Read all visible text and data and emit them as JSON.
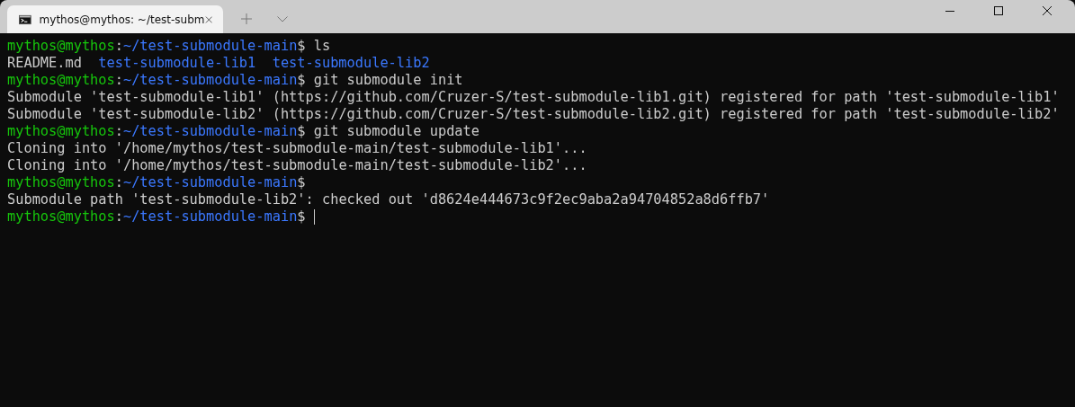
{
  "window": {
    "tabs": [
      {
        "title": "mythos@mythos: ~/test-subm",
        "selected": true
      }
    ]
  },
  "terminal": {
    "lines": [
      {
        "kind": "prompt",
        "user": "mythos@mythos",
        "sep": ":",
        "path": "~/test-submodule-main",
        "command": "$ ls"
      },
      {
        "kind": "listing",
        "items": [
          {
            "kind": "file",
            "text": "README.md"
          },
          {
            "kind": "dir",
            "text": "test-submodule-lib1"
          },
          {
            "kind": "dir",
            "text": "test-submodule-lib2"
          }
        ]
      },
      {
        "kind": "prompt",
        "user": "mythos@mythos",
        "sep": ":",
        "path": "~/test-submodule-main",
        "command": "$ git submodule init"
      },
      {
        "kind": "output",
        "text": "Submodule 'test-submodule-lib1' (https://github.com/Cruzer-S/test-submodule-lib1.git) registered for path 'test-submodule-lib1'"
      },
      {
        "kind": "output",
        "text": "Submodule 'test-submodule-lib2' (https://github.com/Cruzer-S/test-submodule-lib2.git) registered for path 'test-submodule-lib2'"
      },
      {
        "kind": "prompt",
        "user": "mythos@mythos",
        "sep": ":",
        "path": "~/test-submodule-main",
        "command": "$ git submodule update"
      },
      {
        "kind": "output",
        "text": "Cloning into '/home/mythos/test-submodule-main/test-submodule-lib1'..."
      },
      {
        "kind": "output",
        "text": "Cloning into '/home/mythos/test-submodule-main/test-submodule-lib2'..."
      },
      {
        "kind": "prompt",
        "user": "mythos@mythos",
        "sep": ":",
        "path": "~/test-submodule-main",
        "command": "$"
      },
      {
        "kind": "output",
        "text": "Submodule path 'test-submodule-lib2': checked out 'd8624e444673c9f2ec9aba2a94704852a8d6ffb7'"
      },
      {
        "kind": "prompt",
        "user": "mythos@mythos",
        "sep": ":",
        "path": "~/test-submodule-main",
        "command": "$",
        "cursor": true
      }
    ]
  }
}
